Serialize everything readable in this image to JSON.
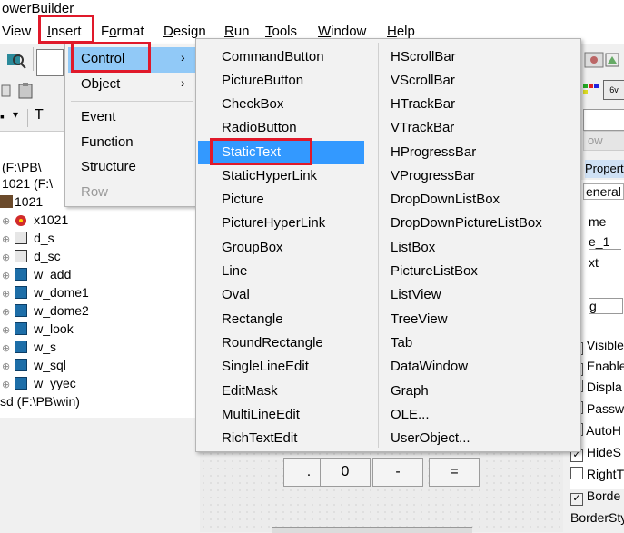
{
  "app": {
    "title": "owerBuilder"
  },
  "menubar": {
    "items": [
      {
        "label": "View",
        "ul": ""
      },
      {
        "label": "Insert",
        "ul": "I"
      },
      {
        "label": "Format",
        "ul": "o"
      },
      {
        "label": "Design",
        "ul": "D"
      },
      {
        "label": "Run",
        "ul": "R"
      },
      {
        "label": "Tools",
        "ul": "T"
      },
      {
        "label": "Window",
        "ul": "W"
      },
      {
        "label": "Help",
        "ul": "H"
      }
    ]
  },
  "insert_menu": {
    "items": [
      "Control",
      "Object",
      "Event",
      "Function",
      "Structure",
      "Row"
    ]
  },
  "control_submenu": {
    "col1": [
      "CommandButton",
      "PictureButton",
      "CheckBox",
      "RadioButton",
      "StaticText",
      "StaticHyperLink",
      "Picture",
      "PictureHyperLink",
      "GroupBox",
      "Line",
      "Oval",
      "Rectangle",
      "RoundRectangle",
      "SingleLineEdit",
      "EditMask",
      "MultiLineEdit",
      "RichTextEdit"
    ],
    "col2": [
      "HScrollBar",
      "VScrollBar",
      "HTrackBar",
      "VTrackBar",
      "HProgressBar",
      "VProgressBar",
      "DropDownListBox",
      "DropDownPictureListBox",
      "ListBox",
      "PictureListBox",
      "ListView",
      "TreeView",
      "Tab",
      "DataWindow",
      "Graph",
      "OLE...",
      "UserObject..."
    ]
  },
  "tree": {
    "path1": "(F:\\PB\\",
    "path2": "1021 (F:\\",
    "path3": "1021",
    "items": [
      "x1021",
      "d_s",
      "d_sc",
      "w_add",
      "w_dome1",
      "w_dome2",
      "w_look",
      "w_s",
      "w_sql",
      "w_yyec"
    ],
    "footer": "sd (F:\\PB\\win)"
  },
  "design": {
    "buttons": [
      ".",
      "0",
      "-",
      "="
    ]
  },
  "right_panel": {
    "tab_properties": "Properti",
    "tab_general": "eneral",
    "labels": [
      "me",
      "e_1",
      "xt",
      "g"
    ],
    "checks": [
      {
        "label": "Visible",
        "checked": true
      },
      {
        "label": "Enable",
        "checked": true
      },
      {
        "label": "Displa",
        "checked": false
      },
      {
        "label": "Passw",
        "checked": false
      },
      {
        "label": "AutoH",
        "checked": false
      },
      {
        "label": "HideS",
        "checked": true
      },
      {
        "label": "RightT",
        "checked": false
      },
      {
        "label": "Borde",
        "checked": true
      }
    ],
    "border_style": "BorderSty"
  },
  "colors": {
    "highlight": "#3399ff",
    "hover": "#91c9f7",
    "annotation": "#e0192a"
  }
}
